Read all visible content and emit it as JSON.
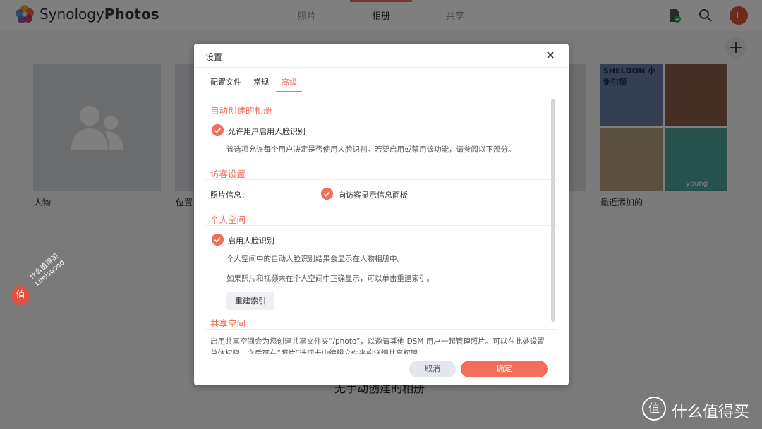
{
  "app": {
    "brand_prefix": "Synology",
    "brand_suffix": "Photos",
    "user_initial": "L"
  },
  "nav": {
    "tabs": [
      "照片",
      "相册",
      "共享"
    ],
    "active": "相册"
  },
  "albums": [
    {
      "label": "人物"
    },
    {
      "label": "位置"
    },
    {
      "label": "最近添加的"
    }
  ],
  "thumbnails": {
    "banner_text": "SHELDON 小谢尔顿",
    "caption": "young"
  },
  "empty_text": "无手动创建的相册",
  "watermark": {
    "line1": "什么值得买",
    "line2": "Lifeisgood",
    "badge": "值",
    "corner_text": "什么值得买",
    "corner_badge": "值"
  },
  "dialog": {
    "title": "设置",
    "tabs": [
      "配置文件",
      "常规",
      "高级"
    ],
    "active_tab": "高级",
    "sections": {
      "auto_album": {
        "title": "自动创建的相册",
        "option": "允许用户启用人脸识别",
        "desc": "该选项允许每个用户决定是否使用人脸识别。若要启用或禁用该功能，请参阅以下部分。"
      },
      "visitor": {
        "title": "访客设置",
        "field_label": "照片信息：",
        "option": "向访客显示信息面板"
      },
      "personal": {
        "title": "个人空间",
        "option": "启用人脸识别",
        "desc1": "个人空间中的自动人脸识别结果会显示在人物相册中。",
        "desc2": "如果照片和视频未在个人空间中正确显示，可以单击重建索引。",
        "reindex_button": "重建索引"
      },
      "shared": {
        "title": "共享空间",
        "desc": "启用共享空间会为您创建共享文件夹“/photo”，以邀请其他 DSM 用户一起管理照片。可以在此处设置总体权限，之后可在“照片”选项卡中编辑文件夹的详细共享权限。"
      }
    },
    "cancel_label": "取消",
    "ok_label": "确定"
  },
  "colors": {
    "accent": "#f26d5a",
    "avatar": "#e0523f"
  }
}
